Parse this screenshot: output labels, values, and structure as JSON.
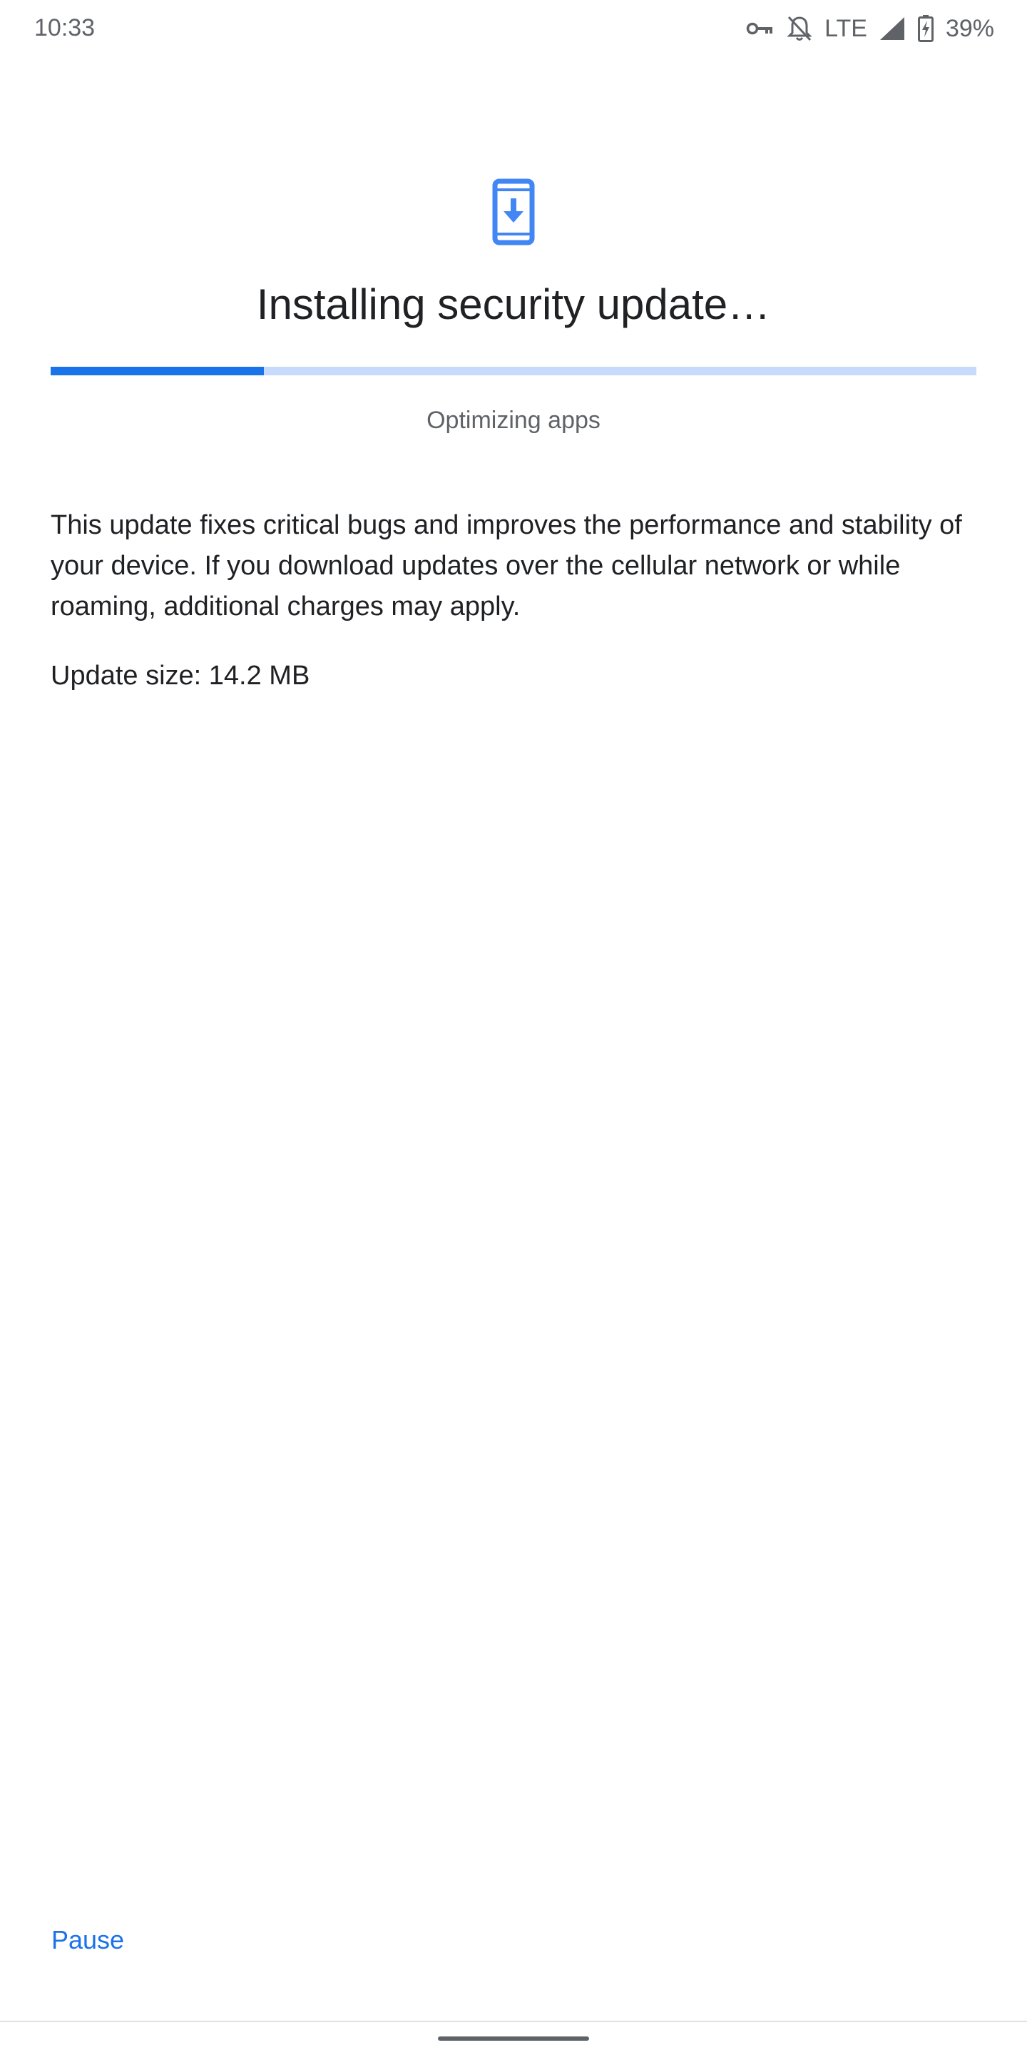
{
  "status_bar": {
    "time": "10:33",
    "network": "LTE",
    "battery": "39%",
    "icons": [
      "vpn-key-icon",
      "notifications-off-icon",
      "signal-icon",
      "battery-charging-icon"
    ]
  },
  "hero": {
    "icon": "system-update-icon",
    "accent_color": "#4285f4"
  },
  "title": "Installing security update…",
  "progress": {
    "fraction": 0.23,
    "fill_color": "#1a73e8",
    "track_color": "#c6dafc",
    "status_text": "Optimizing apps"
  },
  "description": "This update fixes critical bugs and improves the performance and stability of your device. If you download updates over the cellular network or while roaming, additional charges may apply.",
  "update_size": "Update size: 14.2 MB",
  "actions": {
    "pause_label": "Pause"
  }
}
